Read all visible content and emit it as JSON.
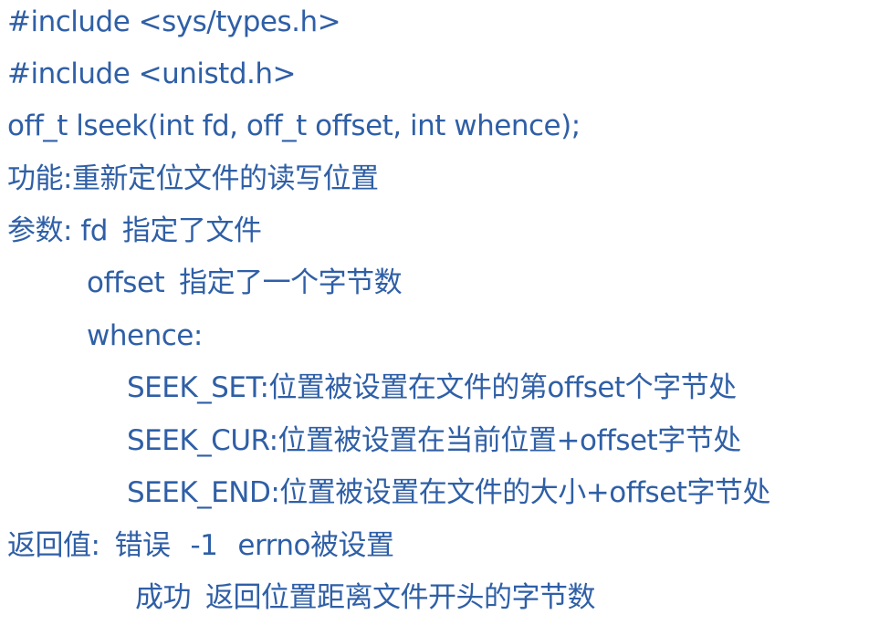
{
  "lines": {
    "include1": "#include <sys/types.h>",
    "include2": "#include <unistd.h>",
    "signature": "off_t lseek(int fd, off_t offset, int whence);",
    "function": "功能:重新定位文件的读写位置",
    "params_label": "参数:",
    "param_fd_name": "fd",
    "param_fd_desc": "指定了文件",
    "param_offset_name": "offset",
    "param_offset_desc": "指定了一个字节数",
    "param_whence": "whence:",
    "seek_set": "SEEK_SET:位置被设置在文件的第offset个字节处",
    "seek_cur": "SEEK_CUR:位置被设置在当前位置+offset字节处",
    "seek_end": "SEEK_END:位置被设置在文件的大小+offset字节处",
    "return_label": "返回值:",
    "return_error": "错误",
    "return_error_value": "-1",
    "return_error_note": "errno被设置",
    "return_success": "成功",
    "return_success_desc": "返回位置距离文件开头的字节数"
  },
  "colors": {
    "text": "#2f5fa6",
    "background": "#ffffff"
  }
}
